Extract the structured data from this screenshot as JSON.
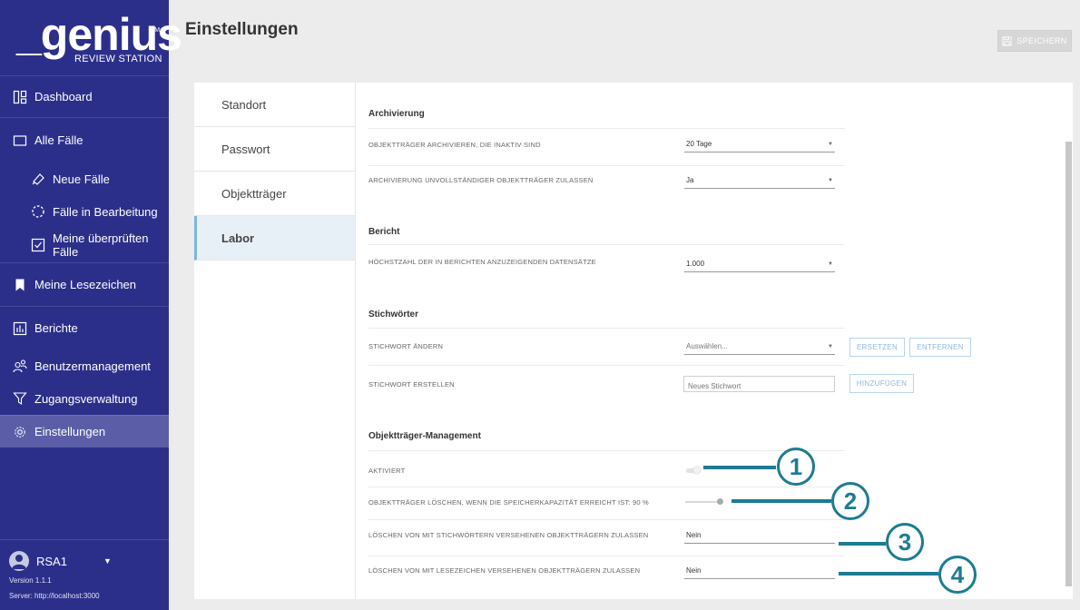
{
  "app": {
    "logo_word": "_genius",
    "logo_tm": "TM",
    "logo_subtitle": "REVIEW STATION"
  },
  "sidebar": {
    "items": [
      {
        "label": "Dashboard",
        "icon": "dashboard-icon"
      },
      {
        "label": "Alle Fälle",
        "icon": "folder-icon"
      },
      {
        "label": "Neue Fälle",
        "icon": "slide-icon"
      },
      {
        "label": "Fälle in Bearbeitung",
        "icon": "progress-circle-icon"
      },
      {
        "label": "Meine überprüften Fälle",
        "icon": "checkbox-icon"
      },
      {
        "label": "Meine Lesezeichen",
        "icon": "bookmark-icon"
      },
      {
        "label": "Berichte",
        "icon": "bar-chart-icon"
      },
      {
        "label": "Benutzermanagement",
        "icon": "users-icon"
      },
      {
        "label": "Zugangsverwaltung",
        "icon": "access-icon"
      },
      {
        "label": "Einstellungen",
        "icon": "gear-icon"
      }
    ],
    "user": {
      "name": "RSA1",
      "version": "Version 1.1.1",
      "server": "Server: http://localhost:3000"
    }
  },
  "header": {
    "title": "Einstellungen",
    "save_label": "SPEICHERN"
  },
  "subnav": {
    "items": [
      "Standort",
      "Passwort",
      "Objektträger",
      "Labor"
    ],
    "active": "Labor"
  },
  "settings": {
    "archivierung": {
      "title": "Archivierung",
      "row1_label": "OBJEKTTRÄGER ARCHIVIEREN, DIE INAKTIV SIND",
      "row1_value": "20 Tage",
      "row2_label": "ARCHIVIERUNG UNVOLLSTÄNDIGER OBJEKTTRÄGER ZULASSEN",
      "row2_value": "Ja"
    },
    "bericht": {
      "title": "Bericht",
      "row1_label": "HÖCHSTZAHL DER IN BERICHTEN ANZUZEIGENDEN DATENSÄTZE",
      "row1_value": "1.000"
    },
    "stichwoerter": {
      "title": "Stichwörter",
      "row1_label": "STICHWORT ÄNDERN",
      "row1_placeholder": "Auswählen...",
      "replace_label": "ERSETZEN",
      "remove_label": "ENTFERNEN",
      "row2_label": "STICHWORT ERSTELLEN",
      "row2_placeholder": "Neues Stichwort",
      "add_label": "HINZUFÜGEN"
    },
    "objekttraeger": {
      "title": "Objektträger-Management",
      "row1_label": "AKTIVIERT",
      "row1_toggle_on": false,
      "row2_label": "OBJEKTTRÄGER LÖSCHEN, WENN DIE SPEICHERKAPAZITÄT ERREICHT IST: 90 %",
      "row2_slider_percent": 90,
      "row3_label": "LÖSCHEN VON MIT STICHWÖRTERN VERSEHENEN OBJEKTTRÄGERN ZULASSEN",
      "row3_value": "Nein",
      "row4_label": "LÖSCHEN VON MIT LESEZEICHEN VERSEHENEN OBJEKTTRÄGERN ZULASSEN",
      "row4_value": "Nein"
    }
  },
  "callouts": [
    "1",
    "2",
    "3",
    "4"
  ],
  "colors": {
    "sidebar_bg": "#2c2f8a",
    "sidebar_active": "#5b5ea6",
    "callout": "#1e7b93",
    "subnav_active_bg": "#e8f0f7",
    "subnav_active_border": "#7fb3dc"
  }
}
